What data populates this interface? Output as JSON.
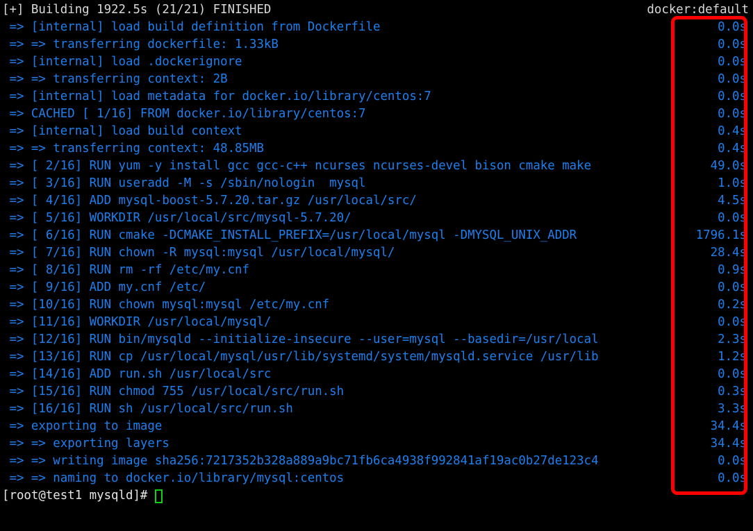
{
  "terminal": {
    "title": "[+] Building 1922.5s (21/21) FINISHED",
    "context": "docker:default",
    "colors": {
      "background": "#000000",
      "step_text": "#1d7fee",
      "header_text": "#d8d8d8",
      "prompt_text": "#e6e6e6",
      "annotation": "#fe0000",
      "cursor": "#14d014"
    },
    "annotation": {
      "name": "red-highlight-box",
      "target": "build-step-durations-column"
    },
    "lines": [
      {
        "text": " => [internal] load build definition from Dockerfile",
        "time": "0.0s"
      },
      {
        "text": " => => transferring dockerfile: 1.33kB",
        "time": "0.0s"
      },
      {
        "text": " => [internal] load .dockerignore",
        "time": "0.0s"
      },
      {
        "text": " => => transferring context: 2B",
        "time": "0.0s"
      },
      {
        "text": " => [internal] load metadata for docker.io/library/centos:7",
        "time": "0.0s"
      },
      {
        "text": " => CACHED [ 1/16] FROM docker.io/library/centos:7",
        "time": "0.0s"
      },
      {
        "text": " => [internal] load build context",
        "time": "0.4s"
      },
      {
        "text": " => => transferring context: 48.85MB",
        "time": "0.4s"
      },
      {
        "text": " => [ 2/16] RUN yum -y install gcc gcc-c++ ncurses ncurses-devel bison cmake make",
        "time": "49.0s"
      },
      {
        "text": " => [ 3/16] RUN useradd -M -s /sbin/nologin  mysql",
        "time": "1.0s"
      },
      {
        "text": " => [ 4/16] ADD mysql-boost-5.7.20.tar.gz /usr/local/src/",
        "time": "4.5s"
      },
      {
        "text": " => [ 5/16] WORKDIR /usr/local/src/mysql-5.7.20/",
        "time": "0.0s"
      },
      {
        "text": " => [ 6/16] RUN cmake -DCMAKE_INSTALL_PREFIX=/usr/local/mysql -DMYSQL_UNIX_ADDR",
        "time": "1796.1s"
      },
      {
        "text": " => [ 7/16] RUN chown -R mysql:mysql /usr/local/mysql/",
        "time": "28.4s"
      },
      {
        "text": " => [ 8/16] RUN rm -rf /etc/my.cnf",
        "time": "0.9s"
      },
      {
        "text": " => [ 9/16] ADD my.cnf /etc/",
        "time": "0.0s"
      },
      {
        "text": " => [10/16] RUN chown mysql:mysql /etc/my.cnf",
        "time": "0.2s"
      },
      {
        "text": " => [11/16] WORKDIR /usr/local/mysql/",
        "time": "0.0s"
      },
      {
        "text": " => [12/16] RUN bin/mysqld --initialize-insecure --user=mysql --basedir=/usr/local",
        "time": "2.3s"
      },
      {
        "text": " => [13/16] RUN cp /usr/local/mysql/usr/lib/systemd/system/mysqld.service /usr/lib",
        "time": "1.2s"
      },
      {
        "text": " => [14/16] ADD run.sh /usr/local/src",
        "time": "0.0s"
      },
      {
        "text": " => [15/16] RUN chmod 755 /usr/local/src/run.sh",
        "time": "0.3s"
      },
      {
        "text": " => [16/16] RUN sh /usr/local/src/run.sh",
        "time": "3.3s"
      },
      {
        "text": " => exporting to image",
        "time": "34.4s"
      },
      {
        "text": " => => exporting layers",
        "time": "34.4s"
      },
      {
        "text": " => => writing image sha256:7217352b328a889a9bc71fb6ca4938f992841af19ac0b27de123c4",
        "time": "0.0s"
      },
      {
        "text": " => => naming to docker.io/library/mysql:centos",
        "time": "0.0s"
      }
    ],
    "prompt": "[root@test1 mysqld]# "
  }
}
